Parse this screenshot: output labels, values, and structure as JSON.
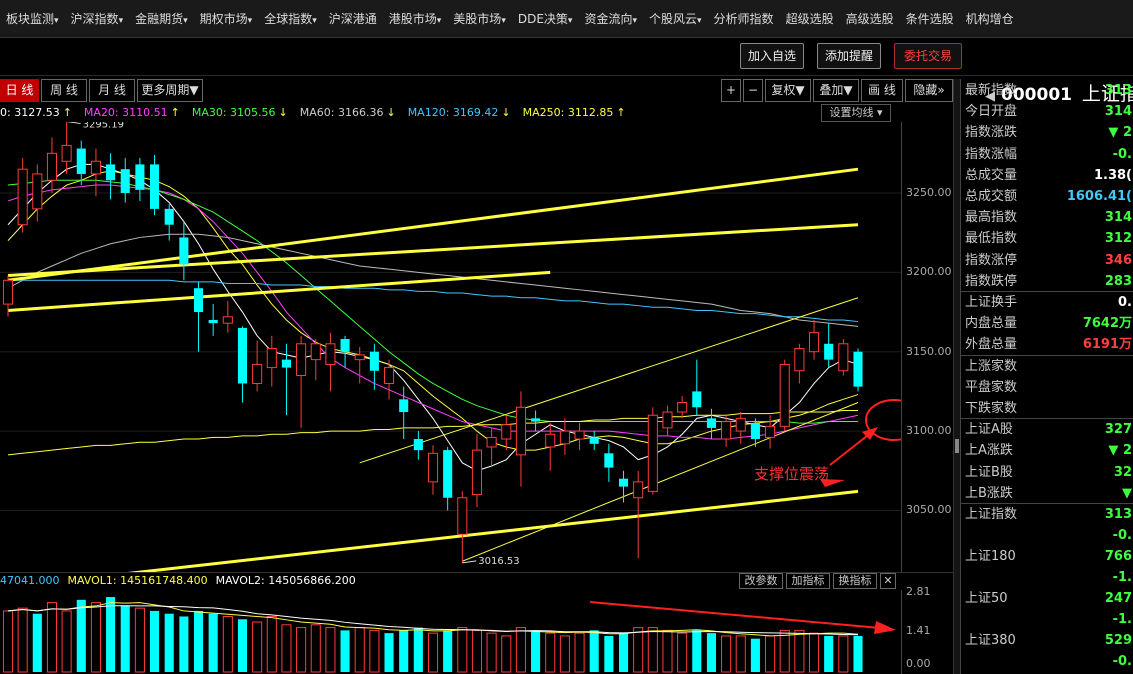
{
  "menu": [
    "板块监测",
    "沪深指数",
    "金融期货",
    "期权市场",
    "全球指数",
    "沪深港通",
    "港股市场",
    "美股市场",
    "DDE决策",
    "资金流向",
    "个股风云",
    "分析师指数",
    "超级选股",
    "高级选股",
    "条件选股",
    "机构增仓"
  ],
  "menu_dropdown": [
    true,
    true,
    true,
    true,
    true,
    false,
    true,
    true,
    true,
    true,
    true,
    false,
    false,
    false,
    false,
    false
  ],
  "toolbar": {
    "add_watch": "加入自选",
    "add_alert": "添加提醒",
    "trade": "委托交易"
  },
  "title": {
    "code": "000001",
    "name": "上证指"
  },
  "tabs": [
    "日 线",
    "周 线",
    "月 线",
    "更多周期"
  ],
  "controls": {
    "plus": "+",
    "minus": "−",
    "restore": "复权",
    "overlay": "叠加",
    "draw": "画 线",
    "hide": "隐藏"
  },
  "ma_legend": [
    {
      "text": "0: 3127.53",
      "color": "#ffffff"
    },
    {
      "text": "MA20: 3110.51",
      "color": "#ff40ff"
    },
    {
      "text": "MA30: 3105.56",
      "color": "#40ff40"
    },
    {
      "text": "MA60: 3166.36",
      "color": "#cccccc"
    },
    {
      "text": "MA120: 3169.42",
      "color": "#40c8ff"
    },
    {
      "text": "MA250: 3112.85",
      "color": "#ffff40"
    }
  ],
  "ma_arrows": [
    "↑",
    "↑",
    "↓",
    "↓",
    "↓",
    "↑"
  ],
  "set_ma": "设置均线",
  "price_axis": {
    "ticks": [
      3250,
      3200,
      3150,
      3100,
      3050
    ],
    "labels": [
      "3250.00",
      "3200.00",
      "3150.00",
      "3100.00",
      "3050.00"
    ],
    "min": 3015,
    "max": 3290
  },
  "annotations": {
    "high": "3295.19",
    "low": "3016.53",
    "support": "支撑位震荡"
  },
  "chart_data": {
    "type": "candlestick",
    "ylim": [
      3015,
      3290
    ],
    "candles": [
      {
        "o": 3180,
        "c": 3195,
        "h": 3198,
        "l": 3172
      },
      {
        "o": 3230,
        "c": 3265,
        "h": 3272,
        "l": 3225
      },
      {
        "o": 3240,
        "c": 3262,
        "h": 3268,
        "l": 3232
      },
      {
        "o": 3258,
        "c": 3275,
        "h": 3285,
        "l": 3250
      },
      {
        "o": 3270,
        "c": 3280,
        "h": 3295,
        "l": 3262
      },
      {
        "o": 3278,
        "c": 3262,
        "h": 3283,
        "l": 3255
      },
      {
        "o": 3262,
        "c": 3270,
        "h": 3278,
        "l": 3248
      },
      {
        "o": 3268,
        "c": 3258,
        "h": 3275,
        "l": 3246
      },
      {
        "o": 3265,
        "c": 3250,
        "h": 3272,
        "l": 3244
      },
      {
        "o": 3268,
        "c": 3252,
        "h": 3272,
        "l": 3245
      },
      {
        "o": 3268,
        "c": 3240,
        "h": 3274,
        "l": 3236
      },
      {
        "o": 3240,
        "c": 3230,
        "h": 3243,
        "l": 3220
      },
      {
        "o": 3222,
        "c": 3205,
        "h": 3232,
        "l": 3195
      },
      {
        "o": 3190,
        "c": 3175,
        "h": 3194,
        "l": 3150
      },
      {
        "o": 3170,
        "c": 3168,
        "h": 3180,
        "l": 3160
      },
      {
        "o": 3168,
        "c": 3172,
        "h": 3182,
        "l": 3162
      },
      {
        "o": 3165,
        "c": 3130,
        "h": 3166,
        "l": 3118
      },
      {
        "o": 3130,
        "c": 3142,
        "h": 3157,
        "l": 3125
      },
      {
        "o": 3140,
        "c": 3152,
        "h": 3160,
        "l": 3128
      },
      {
        "o": 3145,
        "c": 3140,
        "h": 3155,
        "l": 3110
      },
      {
        "o": 3135,
        "c": 3155,
        "h": 3160,
        "l": 3102
      },
      {
        "o": 3145,
        "c": 3155,
        "h": 3158,
        "l": 3132
      },
      {
        "o": 3142,
        "c": 3155,
        "h": 3162,
        "l": 3125
      },
      {
        "o": 3158,
        "c": 3150,
        "h": 3160,
        "l": 3140
      },
      {
        "o": 3145,
        "c": 3148,
        "h": 3153,
        "l": 3130
      },
      {
        "o": 3150,
        "c": 3138,
        "h": 3155,
        "l": 3126
      },
      {
        "o": 3130,
        "c": 3140,
        "h": 3145,
        "l": 3120
      },
      {
        "o": 3120,
        "c": 3112,
        "h": 3128,
        "l": 3095
      },
      {
        "o": 3095,
        "c": 3088,
        "h": 3100,
        "l": 3082
      },
      {
        "o": 3068,
        "c": 3086,
        "h": 3091,
        "l": 3060
      },
      {
        "o": 3088,
        "c": 3058,
        "h": 3090,
        "l": 3050
      },
      {
        "o": 3035,
        "c": 3058,
        "h": 3062,
        "l": 3017
      },
      {
        "o": 3060,
        "c": 3088,
        "h": 3098,
        "l": 3052
      },
      {
        "o": 3090,
        "c": 3096,
        "h": 3102,
        "l": 3078
      },
      {
        "o": 3095,
        "c": 3104,
        "h": 3110,
        "l": 3088
      },
      {
        "o": 3085,
        "c": 3115,
        "h": 3125,
        "l": 3065
      },
      {
        "o": 3108,
        "c": 3106,
        "h": 3113,
        "l": 3100
      },
      {
        "o": 3090,
        "c": 3098,
        "h": 3105,
        "l": 3075
      },
      {
        "o": 3092,
        "c": 3100,
        "h": 3108,
        "l": 3085
      },
      {
        "o": 3095,
        "c": 3100,
        "h": 3105,
        "l": 3088
      },
      {
        "o": 3096,
        "c": 3092,
        "h": 3100,
        "l": 3088
      },
      {
        "o": 3086,
        "c": 3077,
        "h": 3092,
        "l": 3068
      },
      {
        "o": 3070,
        "c": 3065,
        "h": 3075,
        "l": 3055
      },
      {
        "o": 3058,
        "c": 3068,
        "h": 3075,
        "l": 3020
      },
      {
        "o": 3062,
        "c": 3110,
        "h": 3115,
        "l": 3060
      },
      {
        "o": 3102,
        "c": 3112,
        "h": 3116,
        "l": 3097
      },
      {
        "o": 3112,
        "c": 3118,
        "h": 3122,
        "l": 3108
      },
      {
        "o": 3125,
        "c": 3115,
        "h": 3145,
        "l": 3110
      },
      {
        "o": 3108,
        "c": 3102,
        "h": 3114,
        "l": 3095
      },
      {
        "o": 3095,
        "c": 3106,
        "h": 3110,
        "l": 3090
      },
      {
        "o": 3100,
        "c": 3108,
        "h": 3112,
        "l": 3092
      },
      {
        "o": 3105,
        "c": 3095,
        "h": 3108,
        "l": 3090
      },
      {
        "o": 3096,
        "c": 3103,
        "h": 3110,
        "l": 3089
      },
      {
        "o": 3103,
        "c": 3142,
        "h": 3145,
        "l": 3100
      },
      {
        "o": 3138,
        "c": 3152,
        "h": 3155,
        "l": 3130
      },
      {
        "o": 3150,
        "c": 3162,
        "h": 3170,
        "l": 3145
      },
      {
        "o": 3155,
        "c": 3145,
        "h": 3168,
        "l": 3140
      },
      {
        "o": 3138,
        "c": 3155,
        "h": 3158,
        "l": 3135
      },
      {
        "o": 3150,
        "c": 3128,
        "h": 3152,
        "l": 3125
      }
    ],
    "ma_lines": [
      {
        "name": "MA5",
        "color": "#ffffff",
        "values": [
          3230,
          3240,
          3250,
          3258,
          3265,
          3268,
          3268,
          3265,
          3262,
          3258,
          3252,
          3244,
          3232,
          3218,
          3202,
          3188,
          3175,
          3160,
          3150,
          3148,
          3146,
          3148,
          3150,
          3149,
          3147,
          3145,
          3142,
          3132,
          3120,
          3108,
          3094,
          3080,
          3075,
          3078,
          3082,
          3092,
          3098,
          3104,
          3100,
          3098,
          3096,
          3094,
          3090,
          3082,
          3085,
          3090,
          3098,
          3108,
          3110,
          3108,
          3106,
          3104,
          3102,
          3110,
          3118,
          3130,
          3140,
          3145,
          3142
        ]
      },
      {
        "name": "MA10",
        "color": "#ffff40",
        "values": [
          3220,
          3230,
          3240,
          3248,
          3255,
          3258,
          3262,
          3264,
          3262,
          3260,
          3258,
          3254,
          3248,
          3240,
          3228,
          3215,
          3205,
          3192,
          3180,
          3170,
          3162,
          3156,
          3152,
          3150,
          3148,
          3145,
          3142,
          3138,
          3130,
          3122,
          3115,
          3108,
          3100,
          3093,
          3090,
          3088,
          3088,
          3090,
          3092,
          3095,
          3096,
          3097,
          3096,
          3094,
          3092,
          3092,
          3094,
          3097,
          3100,
          3102,
          3104,
          3105,
          3106,
          3108,
          3110,
          3113,
          3117,
          3120,
          3123
        ]
      },
      {
        "name": "MA20",
        "color": "#ff40ff",
        "values": [
          3245,
          3248,
          3250,
          3252,
          3253,
          3254,
          3255,
          3255,
          3254,
          3253,
          3252,
          3250,
          3246,
          3240,
          3232,
          3222,
          3212,
          3200,
          3188,
          3175,
          3165,
          3155,
          3146,
          3140,
          3135,
          3130,
          3126,
          3122,
          3118,
          3114,
          3110,
          3106,
          3104,
          3102,
          3100,
          3100,
          3100,
          3100,
          3100,
          3100,
          3100,
          3100,
          3099,
          3098,
          3097,
          3097,
          3096,
          3096,
          3095,
          3095,
          3096,
          3097,
          3098,
          3100,
          3102,
          3104,
          3106,
          3108,
          3110
        ]
      },
      {
        "name": "MA30",
        "color": "#40ff40",
        "values": [
          3255,
          3256,
          3257,
          3258,
          3258,
          3258,
          3258,
          3257,
          3256,
          3254,
          3252,
          3249,
          3246,
          3242,
          3238,
          3232,
          3226,
          3220,
          3213,
          3206,
          3198,
          3190,
          3182,
          3174,
          3166,
          3158,
          3150,
          3143,
          3136,
          3130,
          3125,
          3120,
          3116,
          3113,
          3110,
          3108,
          3107,
          3106,
          3106,
          3106,
          3106,
          3106,
          3106,
          3106,
          3106,
          3106,
          3106,
          3106,
          3106,
          3106,
          3106,
          3106,
          3106,
          3106,
          3105,
          3105,
          3106,
          3106,
          3106
        ]
      },
      {
        "name": "MA60",
        "color": "#bbbbbb",
        "values": [
          3190,
          3195,
          3200,
          3204,
          3208,
          3212,
          3215,
          3218,
          3220,
          3222,
          3223,
          3224,
          3224,
          3224,
          3223,
          3222,
          3220,
          3218,
          3216,
          3214,
          3212,
          3210,
          3208,
          3206,
          3204,
          3203,
          3202,
          3201,
          3200,
          3199,
          3198,
          3197,
          3196,
          3195,
          3194,
          3193,
          3192,
          3191,
          3190,
          3189,
          3188,
          3187,
          3186,
          3185,
          3184,
          3183,
          3182,
          3181,
          3180,
          3178,
          3176,
          3175,
          3174,
          3172,
          3170,
          3169,
          3168,
          3167,
          3166
        ]
      },
      {
        "name": "MA120",
        "color": "#40c8ff",
        "values": [
          3195,
          3195,
          3195,
          3195,
          3195,
          3195,
          3195,
          3195,
          3195,
          3195,
          3195,
          3195,
          3194,
          3194,
          3194,
          3193,
          3193,
          3193,
          3192,
          3192,
          3192,
          3191,
          3191,
          3190,
          3190,
          3190,
          3189,
          3189,
          3188,
          3188,
          3187,
          3187,
          3186,
          3185,
          3185,
          3184,
          3184,
          3183,
          3182,
          3182,
          3181,
          3180,
          3180,
          3179,
          3178,
          3178,
          3177,
          3176,
          3176,
          3175,
          3174,
          3174,
          3173,
          3172,
          3172,
          3171,
          3170,
          3170,
          3169
        ]
      },
      {
        "name": "MA250",
        "color": "#ffff40",
        "values": [
          3085,
          3086,
          3087,
          3088,
          3089,
          3090,
          3091,
          3091,
          3092,
          3093,
          3093,
          3094,
          3095,
          3095,
          3096,
          3096,
          3097,
          3097,
          3098,
          3098,
          3099,
          3099,
          3100,
          3100,
          3100,
          3101,
          3101,
          3102,
          3102,
          3102,
          3103,
          3103,
          3104,
          3104,
          3104,
          3105,
          3105,
          3106,
          3106,
          3106,
          3107,
          3107,
          3108,
          3108,
          3108,
          3109,
          3109,
          3110,
          3110,
          3110,
          3111,
          3111,
          3111,
          3112,
          3112,
          3112,
          3112,
          3113,
          3113
        ]
      }
    ],
    "trend_lines": [
      {
        "color": "#ffff40",
        "width": 3,
        "p1": [
          0,
          3195
        ],
        "p2": [
          58,
          3265
        ]
      },
      {
        "color": "#ffff40",
        "width": 3,
        "p1": [
          0,
          3198
        ],
        "p2": [
          58,
          3230
        ]
      },
      {
        "color": "#ffff40",
        "width": 3,
        "p1": [
          0,
          3176
        ],
        "p2": [
          37,
          3200
        ]
      },
      {
        "color": "#ffff40",
        "width": 3,
        "p1": [
          5,
          3007
        ],
        "p2": [
          58,
          3062
        ]
      },
      {
        "color": "#ffff40",
        "width": 1,
        "p1": [
          24,
          3080
        ],
        "p2": [
          58,
          3184
        ]
      },
      {
        "color": "#ffff40",
        "width": 1,
        "p1": [
          31,
          3018
        ],
        "p2": [
          58,
          3118
        ]
      }
    ]
  },
  "volume": {
    "legend": [
      {
        "text": "47041.000",
        "color": "#40c8ff"
      },
      {
        "text": "MAVOL1: 145161748.400",
        "color": "#ffff40"
      },
      {
        "text": "MAVOL2: 145056866.200",
        "color": "#ffffff"
      }
    ],
    "buttons": [
      "改参数",
      "加指标",
      "换指标",
      "✕"
    ],
    "axis_labels": [
      "2.81",
      "1.41",
      "0.00"
    ],
    "max": 2.81,
    "values": [
      2.2,
      2.3,
      2.1,
      2.5,
      2.2,
      2.6,
      2.5,
      2.7,
      2.4,
      2.3,
      2.2,
      2.1,
      2.0,
      2.2,
      2.1,
      2.0,
      1.9,
      1.8,
      2.0,
      1.7,
      1.6,
      1.7,
      1.6,
      1.5,
      1.6,
      1.5,
      1.4,
      1.5,
      1.6,
      1.4,
      1.5,
      1.6,
      1.5,
      1.4,
      1.3,
      1.6,
      1.5,
      1.4,
      1.3,
      1.4,
      1.5,
      1.3,
      1.4,
      1.6,
      1.6,
      1.5,
      1.4,
      1.5,
      1.4,
      1.3,
      1.3,
      1.2,
      1.3,
      1.5,
      1.5,
      1.4,
      1.3,
      1.3,
      1.3
    ],
    "up": [
      true,
      true,
      false,
      true,
      true,
      false,
      true,
      false,
      false,
      true,
      false,
      false,
      false,
      false,
      false,
      true,
      false,
      true,
      true,
      true,
      true,
      true,
      true,
      false,
      true,
      true,
      false,
      false,
      false,
      true,
      false,
      true,
      true,
      true,
      true,
      true,
      false,
      true,
      true,
      true,
      false,
      false,
      false,
      true,
      true,
      true,
      true,
      false,
      false,
      true,
      true,
      false,
      true,
      true,
      true,
      true,
      false,
      true,
      false
    ]
  },
  "side": [
    {
      "label": "最新指数",
      "value": "313",
      "color": "#40ff40"
    },
    {
      "label": "今日开盘",
      "value": "314",
      "color": "#40ff40"
    },
    {
      "label": "指数涨跌",
      "value": "▼ 2",
      "color": "#40ff40"
    },
    {
      "label": "指数涨幅",
      "value": "-0.",
      "color": "#40ff40"
    },
    {
      "label": "总成交量",
      "value": "1.38(",
      "color": "#ffffff"
    },
    {
      "label": "总成交额",
      "value": "1606.41(",
      "color": "#40c8ff"
    },
    {
      "label": "最高指数",
      "value": "314",
      "color": "#40ff40"
    },
    {
      "label": "最低指数",
      "value": "312",
      "color": "#40ff40"
    },
    {
      "label": "指数涨停",
      "value": "346",
      "color": "#ff4040"
    },
    {
      "label": "指数跌停",
      "value": "283",
      "color": "#40ff40"
    },
    {
      "label": "上证换手",
      "value": "0.",
      "color": "#ffffff"
    },
    {
      "label": "内盘总量",
      "value": "7642万",
      "color": "#40ff40"
    },
    {
      "label": "外盘总量",
      "value": "6191万",
      "color": "#ff4040"
    },
    {
      "label": "上涨家数",
      "value": "",
      "color": "#ff4040"
    },
    {
      "label": "平盘家数",
      "value": "",
      "color": "#ffffff"
    },
    {
      "label": "下跌家数",
      "value": "",
      "color": "#40ff40"
    },
    {
      "label": "上证A股",
      "value": "327",
      "color": "#40ff40"
    },
    {
      "label": "上A涨跌",
      "value": "▼ 2",
      "color": "#40ff40"
    },
    {
      "label": "上证B股",
      "value": "32",
      "color": "#40ff40"
    },
    {
      "label": "上B涨跌",
      "value": "▼",
      "color": "#40ff40"
    },
    {
      "label": "上证指数",
      "value": "313",
      "color": "#40ff40"
    },
    {
      "label": "",
      "value": "-0.",
      "color": "#40ff40"
    },
    {
      "label": "上证180",
      "value": "766",
      "color": "#40ff40"
    },
    {
      "label": "",
      "value": "-1.",
      "color": "#40ff40"
    },
    {
      "label": "上证50",
      "value": "247",
      "color": "#40ff40"
    },
    {
      "label": "",
      "value": "-1.",
      "color": "#40ff40"
    },
    {
      "label": "上证380",
      "value": "529",
      "color": "#40ff40"
    },
    {
      "label": "",
      "value": "-0.",
      "color": "#40ff40"
    }
  ]
}
